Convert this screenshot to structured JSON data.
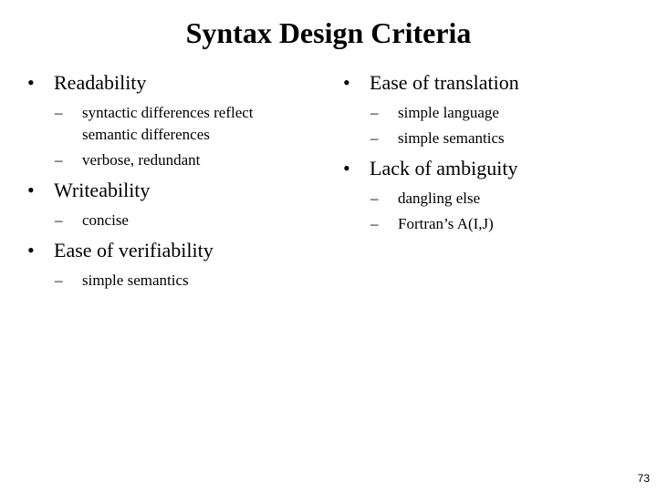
{
  "slide": {
    "title": "Syntax Design Criteria",
    "page_number": "73",
    "bullet_glyph": "•",
    "dash_glyph": "–",
    "left_column": [
      {
        "label": "Readability",
        "subs": [
          "syntactic differences reflect semantic differences",
          "verbose, redundant"
        ]
      },
      {
        "label": "Writeability",
        "subs": [
          "concise"
        ]
      },
      {
        "label": "Ease of verifiability",
        "subs": [
          "simple semantics"
        ]
      }
    ],
    "right_column": [
      {
        "label": "Ease of translation",
        "subs": [
          "simple language",
          "simple semantics"
        ]
      },
      {
        "label": "Lack of ambiguity",
        "subs": [
          "dangling else",
          "Fortran’s A(I,J)"
        ]
      }
    ]
  }
}
